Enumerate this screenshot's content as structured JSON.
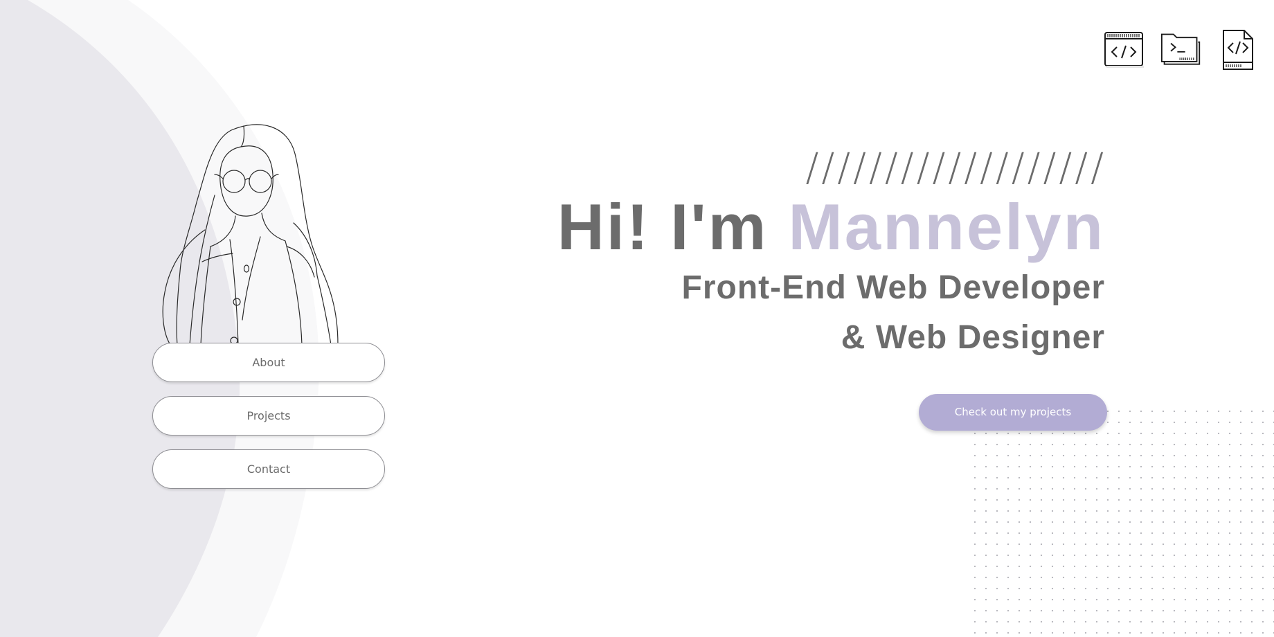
{
  "nav": {
    "items": [
      {
        "label": "About"
      },
      {
        "label": "Projects"
      },
      {
        "label": "Contact"
      }
    ]
  },
  "header_icons": [
    {
      "name": "code-window-icon"
    },
    {
      "name": "terminal-folder-icon"
    },
    {
      "name": "code-file-icon"
    }
  ],
  "hero": {
    "decoration": "///////////////////",
    "greeting": "Hi! I'm",
    "name": "Mannelyn",
    "subtitle_line1": "Front-End Web Developer",
    "subtitle_line2": "& Web Designer",
    "cta_label": "Check out my projects"
  },
  "colors": {
    "accent": "#b2acd4",
    "name_color": "#c7c2d9",
    "text": "#6c6c6c",
    "bg_shape_light": "#f8f8f9",
    "bg_shape_dark": "#e9e8ed"
  }
}
